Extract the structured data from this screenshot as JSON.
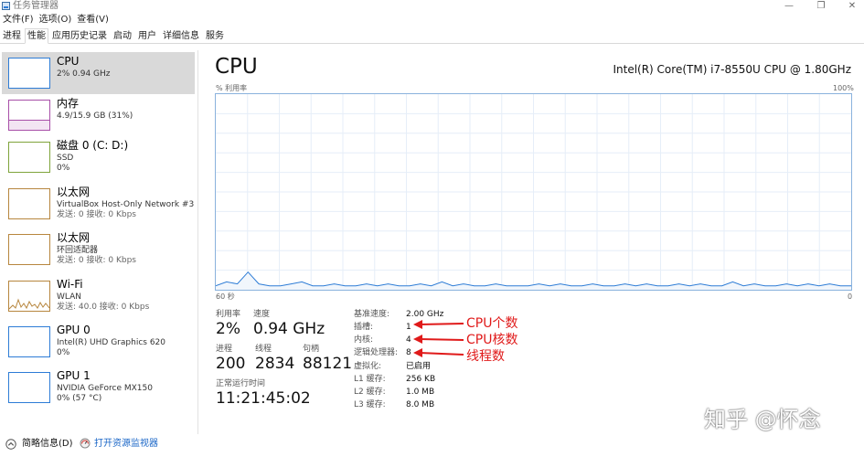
{
  "window": {
    "title": "任务管理器"
  },
  "menu": [
    "文件(F)",
    "选项(O)",
    "查看(V)"
  ],
  "tabs": [
    "进程",
    "性能",
    "应用历史记录",
    "启动",
    "用户",
    "详细信息",
    "服务"
  ],
  "active_tab": "性能",
  "sidebar": {
    "items": [
      {
        "name": "CPU",
        "line1": "2%  0.94 GHz",
        "line2": "",
        "selected": true,
        "icon": "cpu-graph-thumbnail"
      },
      {
        "name": "内存",
        "line1": "4.9/15.9 GB (31%)",
        "line2": "",
        "selected": false,
        "icon": "memory-graph-thumbnail"
      },
      {
        "name": "磁盘 0 (C: D:)",
        "line1": "SSD",
        "line2": "0%",
        "selected": false,
        "icon": "disk-graph-thumbnail"
      },
      {
        "name": "以太网",
        "line1": "VirtualBox Host-Only Network #3",
        "line2": "发送: 0 接收: 0 Kbps",
        "selected": false,
        "icon": "ethernet-graph-thumbnail"
      },
      {
        "name": "以太网",
        "line1": "环回适配器",
        "line2": "发送: 0 接收: 0 Kbps",
        "selected": false,
        "icon": "ethernet-graph-thumbnail"
      },
      {
        "name": "Wi-Fi",
        "line1": "WLAN",
        "line2": "发送: 40.0 接收: 0 Kbps",
        "selected": false,
        "icon": "wifi-graph-thumbnail"
      },
      {
        "name": "GPU 0",
        "line1": "Intel(R) UHD Graphics 620",
        "line2": "0%",
        "selected": false,
        "icon": "gpu-graph-thumbnail"
      },
      {
        "name": "GPU 1",
        "line1": "NVIDIA GeForce MX150",
        "line2": "0% (57 °C)",
        "selected": false,
        "icon": "gpu-graph-thumbnail"
      }
    ]
  },
  "main": {
    "title": "CPU",
    "model": "Intel(R) Core(TM) i7-8550U CPU @ 1.80GHz",
    "graph_label_top_left": "% 利用率",
    "graph_label_top_right": "100%",
    "graph_label_bottom_left": "60 秒",
    "graph_label_bottom_right": "0",
    "utilization_history_percent": [
      2,
      4,
      3,
      9,
      3,
      2,
      2,
      3,
      4,
      2,
      2,
      3,
      2,
      2,
      3,
      2,
      3,
      2,
      2,
      3,
      2,
      4,
      2,
      3,
      2,
      2,
      3,
      2,
      2,
      2,
      3,
      2,
      3,
      2,
      2,
      3,
      2,
      2,
      3,
      2,
      3,
      2,
      2,
      3,
      2,
      3,
      2,
      2,
      4,
      2,
      3,
      2,
      2,
      3,
      2,
      3,
      2,
      3,
      2,
      2
    ],
    "stats": {
      "utilization_label": "利用率",
      "utilization": "2%",
      "speed_label": "速度",
      "speed": "0.94 GHz",
      "processes_label": "进程",
      "processes": "200",
      "threads_label": "线程",
      "threads": "2834",
      "handles_label": "句柄",
      "handles": "88121",
      "uptime_label": "正常运行时间",
      "uptime": "11:21:45:02"
    },
    "details": [
      {
        "label": "基准速度:",
        "value": "2.00 GHz"
      },
      {
        "label": "插槽:",
        "value": "1"
      },
      {
        "label": "内核:",
        "value": "4"
      },
      {
        "label": "逻辑处理器:",
        "value": "8"
      },
      {
        "label": "虚拟化:",
        "value": "已启用"
      },
      {
        "label": "L1 缓存:",
        "value": "256 KB"
      },
      {
        "label": "L2 缓存:",
        "value": "1.0 MB"
      },
      {
        "label": "L3 缓存:",
        "value": "8.0 MB"
      }
    ],
    "annotations": [
      "CPU个数",
      "CPU核数",
      "线程数"
    ],
    "annotation_color": "#e01a1a"
  },
  "footer": {
    "brief_label": "简略信息(D)",
    "monitor_link": "打开资源监视器"
  },
  "watermark": "知乎 @怀念",
  "colors": {
    "cpu_blue": "#2d7cd6",
    "graph_border": "#8ab2dd",
    "grid": "#e6eef8",
    "link": "#1a66c7"
  }
}
